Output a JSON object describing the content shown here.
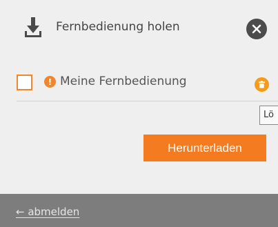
{
  "dialog": {
    "title": "Fernbedienung holen",
    "icons": {
      "title": "download-icon",
      "close": "close-icon",
      "alert": "alert-icon",
      "delete": "trash-icon"
    }
  },
  "remote": {
    "label": "Meine Fernbedienung",
    "alert_symbol": "!",
    "checked": false
  },
  "tooltip": {
    "text": "Lö"
  },
  "actions": {
    "download_label": "Herunterladen"
  },
  "footer": {
    "logout_label": "← abmelden"
  },
  "colors": {
    "accent": "#f47b20",
    "footer": "#7d7d7d",
    "background": "#efefef"
  }
}
